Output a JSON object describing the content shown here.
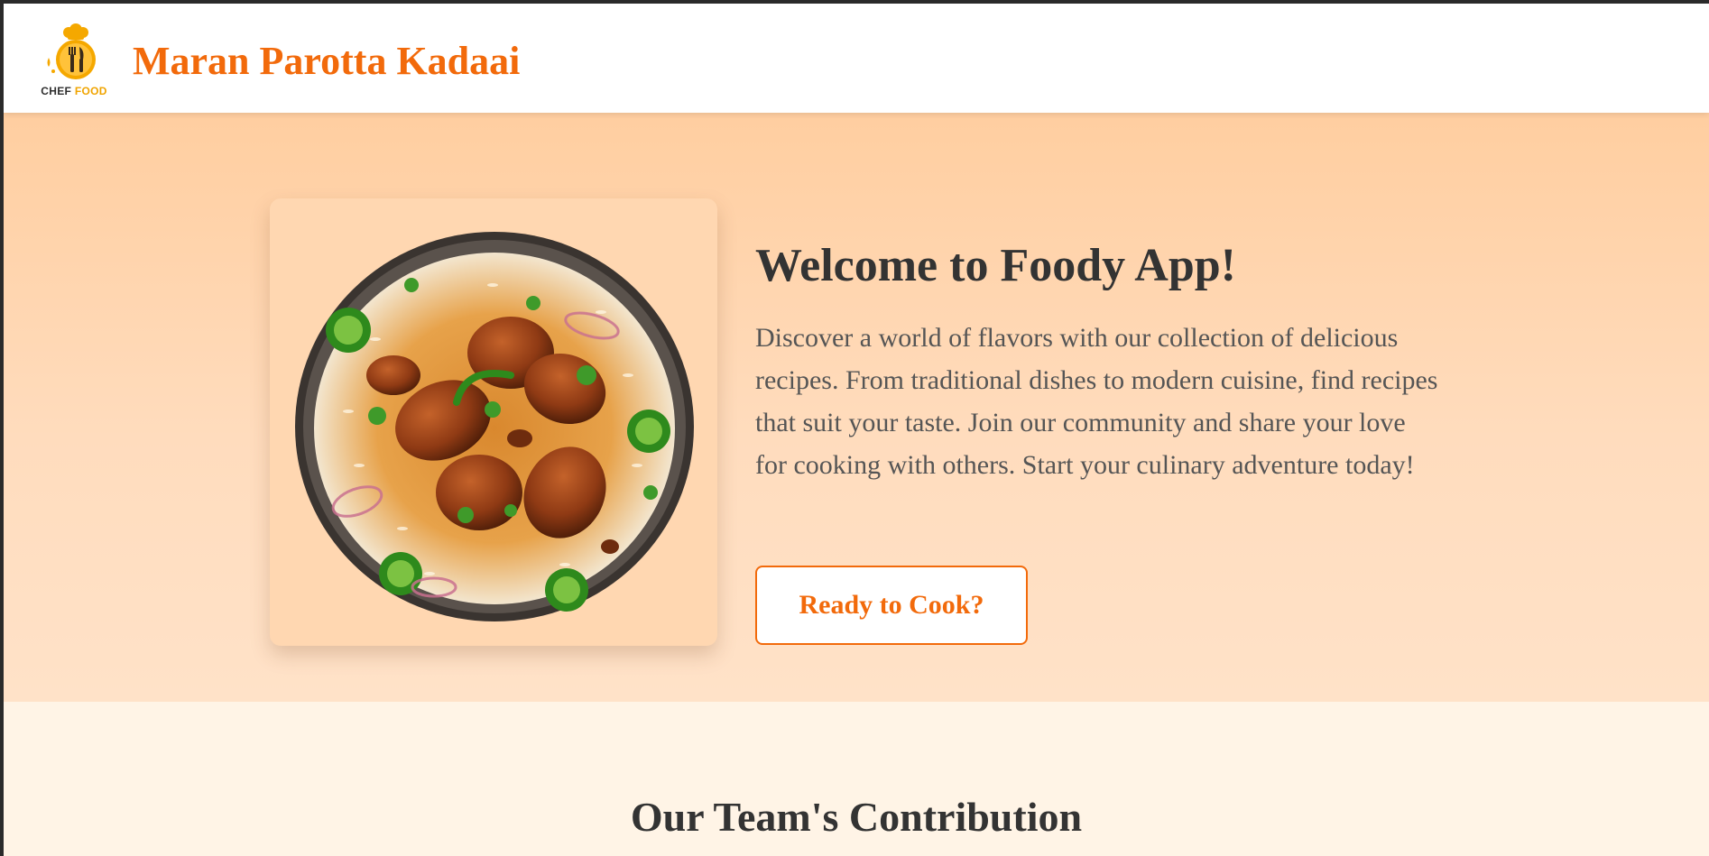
{
  "header": {
    "logo": {
      "icon": "chef-hat-fork-knife-logo",
      "text_primary": "CHEF",
      "text_secondary": "FOOD",
      "colors": {
        "ring": "#f5a800",
        "hat": "#f5a800",
        "utensils": "#3a2a1a"
      }
    },
    "title": "Maran Parotta Kadaai",
    "title_color": "#f26a0b"
  },
  "hero": {
    "image": {
      "icon": "chicken-biryani-plate-image"
    },
    "title": "Welcome to Foody App!",
    "description": "Discover a world of flavors with our collection of delicious recipes. From traditional dishes to modern cuisine, find recipes that suit your taste. Join our community and share your love for cooking with others. Start your culinary adventure today!",
    "cta_label": "Ready to Cook?",
    "accent_color": "#f26a0b",
    "background_top": "#ffcea0",
    "background_bottom": "#ffe2c8"
  },
  "team": {
    "title": "Our Team's Contribution",
    "background": "#fff4e6"
  }
}
